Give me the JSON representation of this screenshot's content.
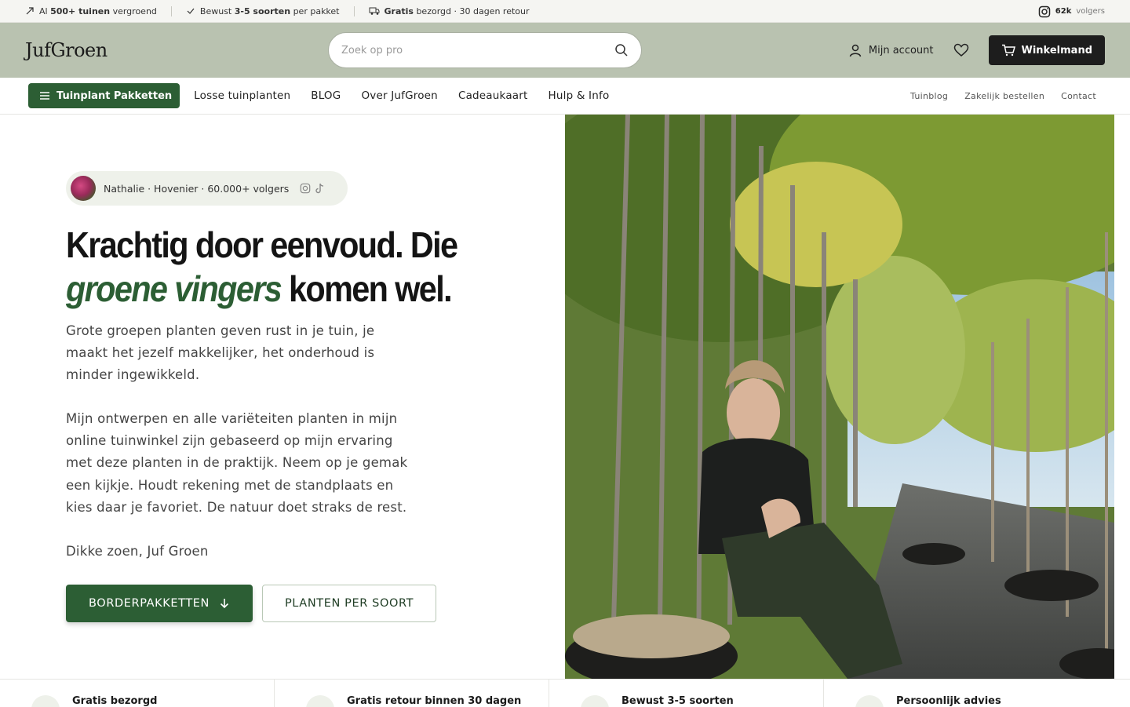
{
  "topbar": {
    "usp1_pre": "Al ",
    "usp1_bold": "500+ tuinen",
    "usp1_post": " vergroend",
    "usp2_pre": "Bewust ",
    "usp2_bold": "3-5 soorten",
    "usp2_post": " per pakket",
    "usp3_bold": "Gratis",
    "usp3_post": " bezorgd · 30 dagen retour",
    "ig_count": "62k",
    "ig_label": "volgers"
  },
  "header": {
    "logo": "JufGroen",
    "search_placeholder": "Zoek op pro",
    "account_label": "Mijn account",
    "cart_label": "Winkelmand"
  },
  "nav": {
    "category_button": "Tuinplant Pakketten",
    "links": [
      "Losse tuinplanten",
      "BLOG",
      "Over JufGroen",
      "Cadeaukaart",
      "Hulp & Info"
    ],
    "right_links": [
      "Tuinblog",
      "Zakelijk bestellen",
      "Contact"
    ]
  },
  "hero": {
    "author": "Nathalie · Hovenier · 60.000+ volgers",
    "headline_line1": "Krachtig door eenvoud. Die",
    "headline_em": "groene vingers",
    "headline_rest": " komen wel.",
    "intro": "Grote groepen planten geven rust in je tuin, je maakt het jezelf makkelijker, het onderhoud is minder ingewikkeld.",
    "paragraph2": "Mijn ontwerpen en alle variëteiten planten in mijn online tuinwinkel zijn gebaseerd op mijn ervaring met deze planten in de praktijk. Neem op je gemak een kijkje. Houdt rekening met de standplaats en kies daar je favoriet. De natuur doet straks de rest.",
    "signature": "Dikke zoen, Juf Groen",
    "primary_button": "BORDERPAKKETTEN",
    "secondary_button": "PLANTEN PER SOORT"
  },
  "usp_strip": [
    "Gratis bezorgd",
    "Gratis retour binnen 30 dagen",
    "Bewust 3-5 soorten",
    "Persoonlijk advies"
  ],
  "colors": {
    "brand_green": "#2c5e34",
    "header_bg": "#b9c2b0",
    "cart_bg": "#1d1d1d"
  }
}
